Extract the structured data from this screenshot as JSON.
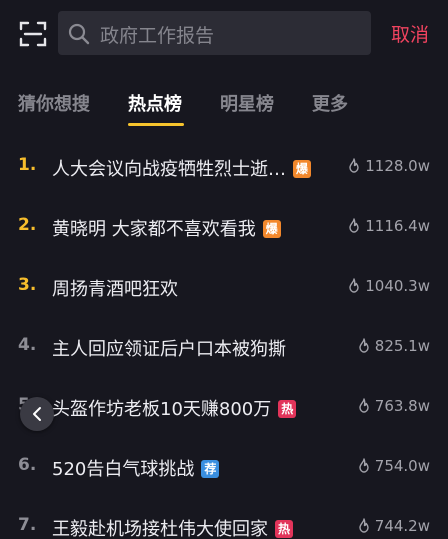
{
  "search": {
    "placeholder_text": "政府工作报告",
    "cancel_label": "取消"
  },
  "tabs": [
    {
      "label": "猜你想搜",
      "active": false
    },
    {
      "label": "热点榜",
      "active": true
    },
    {
      "label": "明星榜",
      "active": false
    },
    {
      "label": "更多",
      "active": false
    }
  ],
  "hot_list": [
    {
      "rank": "1.",
      "title": "人大会议向战疫牺牲烈士逝…",
      "badge": "爆",
      "badge_color": "#f2882c",
      "heat": "1128.0w"
    },
    {
      "rank": "2.",
      "title": "黄晓明 大家都不喜欢看我",
      "badge": "爆",
      "badge_color": "#f2882c",
      "heat": "1116.4w"
    },
    {
      "rank": "3.",
      "title": "周扬青酒吧狂欢",
      "badge": "",
      "badge_color": "",
      "heat": "1040.3w"
    },
    {
      "rank": "4.",
      "title": "主人回应领证后户口本被狗撕",
      "badge": "",
      "badge_color": "",
      "heat": "825.1w"
    },
    {
      "rank": "5.",
      "title": "头盔作坊老板10天赚800万",
      "badge": "热",
      "badge_color": "#e2345a",
      "heat": "763.8w"
    },
    {
      "rank": "6.",
      "title": "520告白气球挑战",
      "badge": "荐",
      "badge_color": "#3a8fe0",
      "heat": "754.0w"
    },
    {
      "rank": "7.",
      "title": "王毅赴机场接杜伟大使回家",
      "badge": "热",
      "badge_color": "#e2345a",
      "heat": "744.2w"
    }
  ],
  "colors": {
    "accent": "#f7c42d",
    "cancel": "#f0435f",
    "background": "#17171f"
  },
  "icons": {
    "scan": "scan-icon",
    "search": "search-icon",
    "flame": "flame-icon",
    "back": "chevron-left-icon"
  }
}
